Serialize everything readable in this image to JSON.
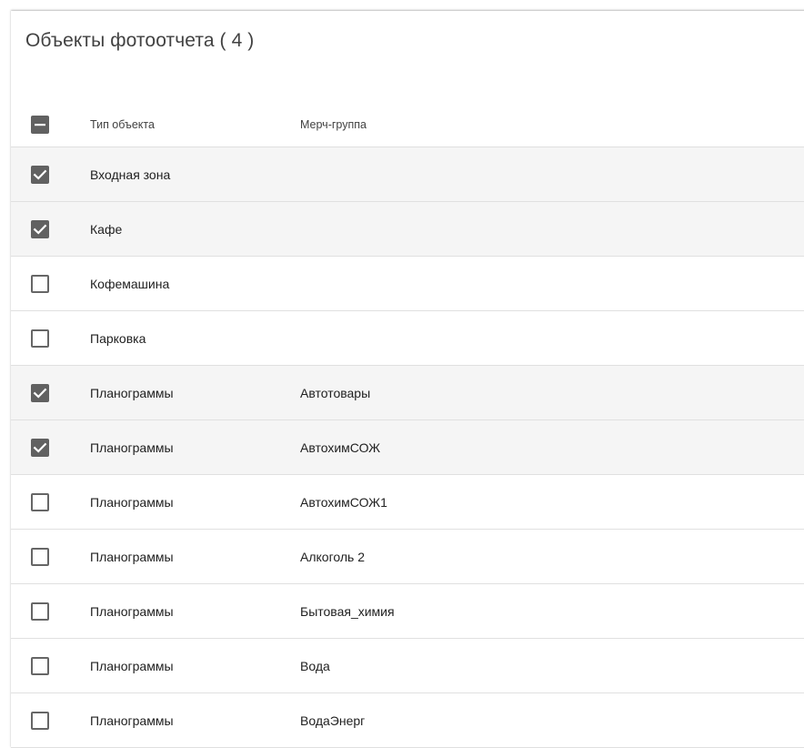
{
  "panel": {
    "title": "Объекты фотоотчета ( 4 )"
  },
  "table": {
    "columns": [
      "Тип объекта",
      "Мерч-группа"
    ],
    "header_checkbox_state": "indeterminate",
    "rows": [
      {
        "type": "Входная зона",
        "group": "",
        "checked": true
      },
      {
        "type": "Кафе",
        "group": "",
        "checked": true
      },
      {
        "type": "Кофемашина",
        "group": "",
        "checked": false
      },
      {
        "type": "Парковка",
        "group": "",
        "checked": false
      },
      {
        "type": "Планограммы",
        "group": "Автотовары",
        "checked": true
      },
      {
        "type": "Планограммы",
        "group": "АвтохимСОЖ",
        "checked": true
      },
      {
        "type": "Планограммы",
        "group": "АвтохимСОЖ1",
        "checked": false
      },
      {
        "type": "Планограммы",
        "group": "Алкоголь 2",
        "checked": false
      },
      {
        "type": "Планограммы",
        "group": "Бытовая_химия",
        "checked": false
      },
      {
        "type": "Планограммы",
        "group": "Вода",
        "checked": false
      },
      {
        "type": "Планограммы",
        "group": "ВодаЭнерг",
        "checked": false
      }
    ]
  },
  "colors": {
    "checkbox": "#616161",
    "selected_row_bg": "#f5f5f5",
    "divider": "#e0e0e0"
  }
}
